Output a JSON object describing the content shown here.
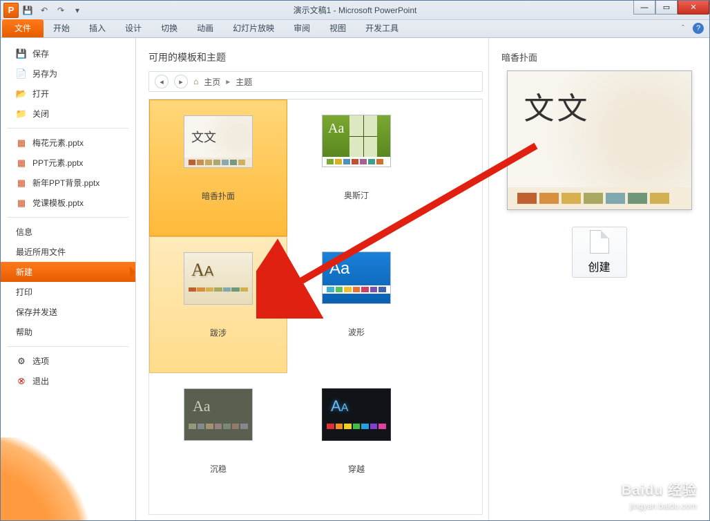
{
  "window": {
    "title": "演示文稿1 - Microsoft PowerPoint"
  },
  "tabs": {
    "file": "文件",
    "home": "开始",
    "insert": "插入",
    "design": "设计",
    "transitions": "切换",
    "animations": "动画",
    "slideshow": "幻灯片放映",
    "review": "审阅",
    "view": "视图",
    "developer": "开发工具"
  },
  "sidebar": {
    "save": "保存",
    "saveas": "另存为",
    "open": "打开",
    "close": "关闭",
    "recent_files": [
      "梅花元素.pptx",
      "PPT元素.pptx",
      "新年PPT背景.pptx",
      "党课模板.pptx"
    ],
    "info": "信息",
    "recent": "最近所用文件",
    "new": "新建",
    "print": "打印",
    "saveSend": "保存并发送",
    "help": "帮助",
    "options": "选项",
    "exit": "退出"
  },
  "main": {
    "section_title": "可用的模板和主题",
    "breadcrumb": {
      "home": "主页",
      "themes": "主题"
    },
    "templates": [
      {
        "key": "anxiang",
        "label": "暗香扑面",
        "state": "selected"
      },
      {
        "key": "austin",
        "label": "奥斯汀",
        "state": ""
      },
      {
        "key": "bashe",
        "label": "跋涉",
        "state": "hover"
      },
      {
        "key": "boxing",
        "label": "波形",
        "state": ""
      },
      {
        "key": "chenwen",
        "label": "沉稳",
        "state": ""
      },
      {
        "key": "chuanyue",
        "label": "穿越",
        "state": ""
      }
    ]
  },
  "preview": {
    "title": "暗香扑面",
    "sample_text": "文文",
    "create": "创建"
  },
  "watermark": {
    "brand": "Baidu 经验",
    "url": "jingyan.baidu.com"
  }
}
